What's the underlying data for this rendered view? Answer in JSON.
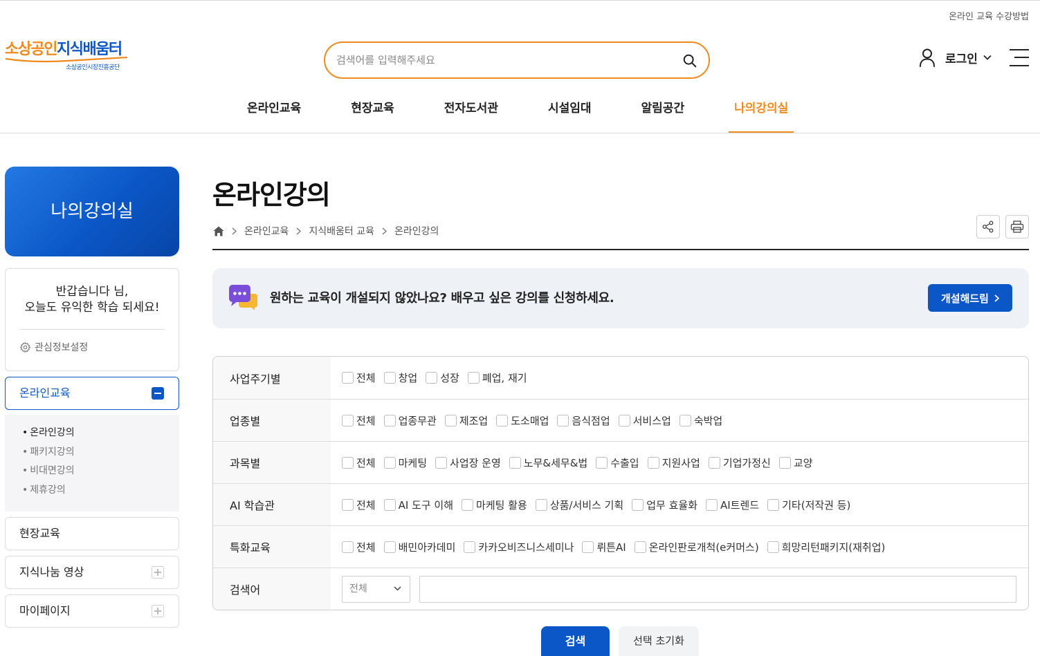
{
  "header": {
    "util_link": "온라인 교육 수강방법"
  },
  "logo": {
    "title_a": "소상공인",
    "title_b": "지식배움터",
    "subtitle": "소상공인시장진흥공단"
  },
  "search": {
    "placeholder": "검색어를 입력해주세요",
    "icon": "search-icon"
  },
  "user": {
    "icon": "person-icon",
    "login_label": "로그인"
  },
  "menu_icon": "hamburger-icon",
  "gnb": [
    {
      "label": "온라인교육",
      "active": false
    },
    {
      "label": "현장교육",
      "active": false
    },
    {
      "label": "전자도서관",
      "active": false
    },
    {
      "label": "시설임대",
      "active": false
    },
    {
      "label": "알림공간",
      "active": false
    },
    {
      "label": "나의강의실",
      "active": true
    }
  ],
  "sidebar": {
    "title": "나의강의실",
    "welcome": {
      "line1": "반갑습니다 님,",
      "line2": "오늘도 유익한 학습 되세요!",
      "settings_icon": "gear-icon",
      "settings": "관심정보설정"
    },
    "menu": [
      {
        "label": "온라인교육",
        "active": true,
        "toggle_icon": "minus-icon",
        "sub": [
          {
            "label": "온라인강의",
            "active": true
          },
          {
            "label": "패키지강의",
            "active": false
          },
          {
            "label": "비대면강의",
            "active": false
          },
          {
            "label": "제휴강의",
            "active": false
          }
        ]
      },
      {
        "label": "현장교육",
        "active": false
      },
      {
        "label": "지식나눔 영상",
        "active": false,
        "toggle_icon": "plus-icon"
      },
      {
        "label": "마이페이지",
        "active": false,
        "toggle_icon": "plus-icon"
      }
    ]
  },
  "page": {
    "title": "온라인강의",
    "breadcrumb": {
      "home_icon": "home-icon",
      "items": [
        "온라인교육",
        "지식배움터 교육",
        "온라인강의"
      ]
    },
    "tools": [
      "share-icon",
      "print-icon"
    ]
  },
  "banner": {
    "icon": "chat-bubble-icon",
    "text": "원하는 교육이 개설되지 않았나요? 배우고 싶은 강의를 신청하세요.",
    "button": "개설해드림"
  },
  "filters": [
    {
      "label": "사업주기별",
      "options": [
        "전체",
        "창업",
        "성장",
        "폐업, 재기"
      ]
    },
    {
      "label": "업종별",
      "options": [
        "전체",
        "업종무관",
        "제조업",
        "도소매업",
        "음식점업",
        "서비스업",
        "숙박업"
      ]
    },
    {
      "label": "과목별",
      "options": [
        "전체",
        "마케팅",
        "사업장 운영",
        "노무&세무&법",
        "수출입",
        "지원사업",
        "기업가정신",
        "교양"
      ]
    },
    {
      "label": "AI 학습관",
      "options": [
        "전체",
        "AI 도구 이해",
        "마케팅 활용",
        "상품/서비스 기획",
        "업무 효율화",
        "AI트렌드",
        "기타(저작권 등)"
      ]
    },
    {
      "label": "특화교육",
      "options": [
        "전체",
        "배민아카데미",
        "카카오비즈니스세미나",
        "뤼튼AI",
        "온라인판로개척(e커머스)",
        "희망리턴패키지(재취업)"
      ]
    }
  ],
  "keyword": {
    "label": "검색어",
    "scope_selected": "전체"
  },
  "actions": {
    "search": "검색",
    "reset": "선택 초기화"
  },
  "colors": {
    "accent_orange": "#f08a1c",
    "brand_blue": "#0b57c7",
    "banner_bg": "#eef2f7"
  }
}
